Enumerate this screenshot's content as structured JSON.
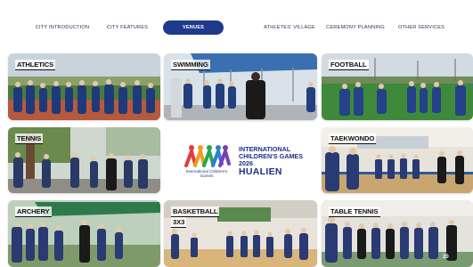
{
  "nav": {
    "items": [
      {
        "label": "CITY INTRODUCTION",
        "active": false
      },
      {
        "label": "CITY FEATURES",
        "active": false
      },
      {
        "label": "VENUES",
        "active": true
      },
      {
        "label": "ATHLETES' VILLAGE",
        "active": false
      },
      {
        "label": "CEREMONY PLANNING",
        "active": false
      },
      {
        "label": "OTHER SERVICES",
        "active": false
      }
    ]
  },
  "venues": [
    {
      "label": "ATHLETICS"
    },
    {
      "label": "SWIMMING"
    },
    {
      "label": "FOOTBALL"
    },
    {
      "label": "TENNIS"
    },
    {
      "label": "TAEKWONDO"
    },
    {
      "label": "ARCHERY"
    },
    {
      "label": "BASKETBALL",
      "label2": "3X3"
    },
    {
      "label": "TABLE TENNIS"
    }
  ],
  "logo": {
    "brand": "International Children's Games",
    "title": "INTERNATIONAL CHILDREN'S GAMES 2026",
    "city": "HUALIEN",
    "colors": [
      "#e23b3b",
      "#f39a1e",
      "#27a84a",
      "#2a7fd4",
      "#7a3fb5"
    ]
  },
  "page_number": "20",
  "colors": {
    "accent": "#1f3a8c",
    "logo_text": "#1e2f86"
  }
}
